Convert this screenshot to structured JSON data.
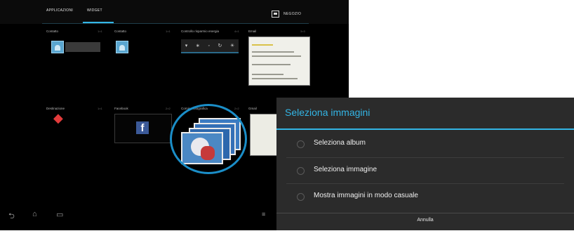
{
  "topbar": {
    "tabs": [
      {
        "label": "APPLICAZIONI"
      },
      {
        "label": "WIDGET"
      }
    ],
    "shop_label": "NEGOZIO"
  },
  "widgets": [
    {
      "label": "Contatto",
      "size": "1×1"
    },
    {
      "label": "Contatto",
      "size": "1×1"
    },
    {
      "label": "Controllo risparmio energia",
      "size": "4×1"
    },
    {
      "label": "Email",
      "size": "3×3"
    },
    {
      "label": "Destinazione",
      "size": "1×1"
    },
    {
      "label": "Facebook",
      "size": "2×2"
    },
    {
      "label": "Cornice fotografica",
      "size": "2×2"
    },
    {
      "label": "Gmail",
      "size": "3×3"
    }
  ],
  "dialog": {
    "title": "Seleziona immagini",
    "options": [
      {
        "label": "Seleziona album"
      },
      {
        "label": "Seleziona immagine"
      },
      {
        "label": "Mostra immagini in modo casuale"
      }
    ],
    "cancel": "Annulla"
  }
}
